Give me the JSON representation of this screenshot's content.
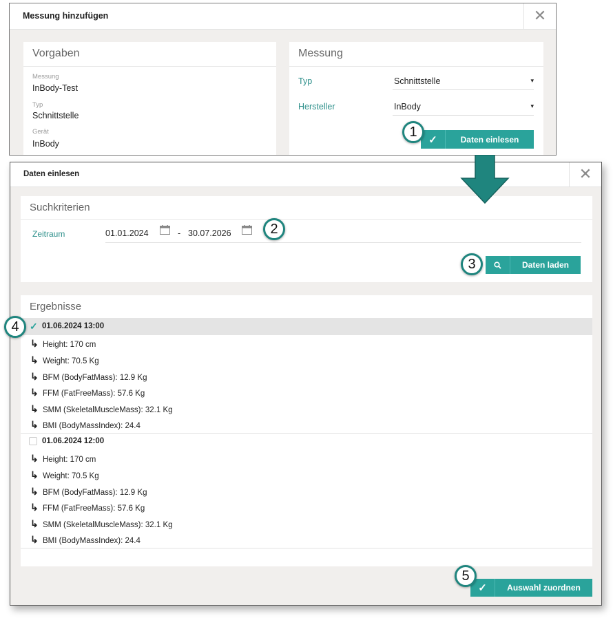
{
  "dialog1": {
    "title": "Messung hinzufügen",
    "close_label": "✕",
    "vorgaben": {
      "title": "Vorgaben",
      "fields": [
        {
          "label": "Messung",
          "value": "InBody-Test"
        },
        {
          "label": "Typ",
          "value": "Schnittstelle"
        },
        {
          "label": "Gerät",
          "value": "InBody"
        }
      ]
    },
    "messung": {
      "title": "Messung",
      "typ_label": "Typ",
      "typ_value": "Schnittstelle",
      "hersteller_label": "Hersteller",
      "hersteller_value": "InBody",
      "button_label": "Daten einlesen"
    }
  },
  "dialog2": {
    "title": "Daten einlesen",
    "close_label": "✕",
    "suchkriterien": {
      "title": "Suchkriterien",
      "zeitraum_label": "Zeitraum",
      "date_from": "01.01.2024",
      "separator": "-",
      "date_to": "30.07.2026",
      "button_label": "Daten laden"
    },
    "ergebnisse": {
      "title": "Ergebnisse",
      "groups": [
        {
          "title": "01.06.2024 13:00",
          "checked": true,
          "items": [
            "Height: 170 cm",
            "Weight: 70.5 Kg",
            "BFM (BodyFatMass): 12.9 Kg",
            "FFM (FatFreeMass): 57.6 Kg",
            "SMM (SkeletalMuscleMass): 32.1 Kg",
            "BMI (BodyMassIndex): 24.4"
          ]
        },
        {
          "title": "01.06.2024 12:00",
          "checked": false,
          "items": [
            "Height: 170 cm",
            "Weight: 70.5 Kg",
            "BFM (BodyFatMass): 12.9 Kg",
            "FFM (FatFreeMass): 57.6 Kg",
            "SMM (SkeletalMuscleMass): 32.1 Kg",
            "BMI (BodyMassIndex): 24.4"
          ]
        }
      ]
    },
    "assign_button_label": "Auswahl zuordnen"
  },
  "annotations": {
    "badges": [
      "1",
      "2",
      "3",
      "4",
      "5"
    ],
    "arrow_color": "#1f857e"
  },
  "colors": {
    "accent": "#2aa39b",
    "label_teal": "#2c8f8a",
    "dialog_bg": "#f1efed"
  },
  "icons": {
    "check": "✓",
    "search": "search-icon",
    "calendar": "calendar-icon",
    "sub_item_arrow": "↳",
    "dropdown": "▾"
  }
}
